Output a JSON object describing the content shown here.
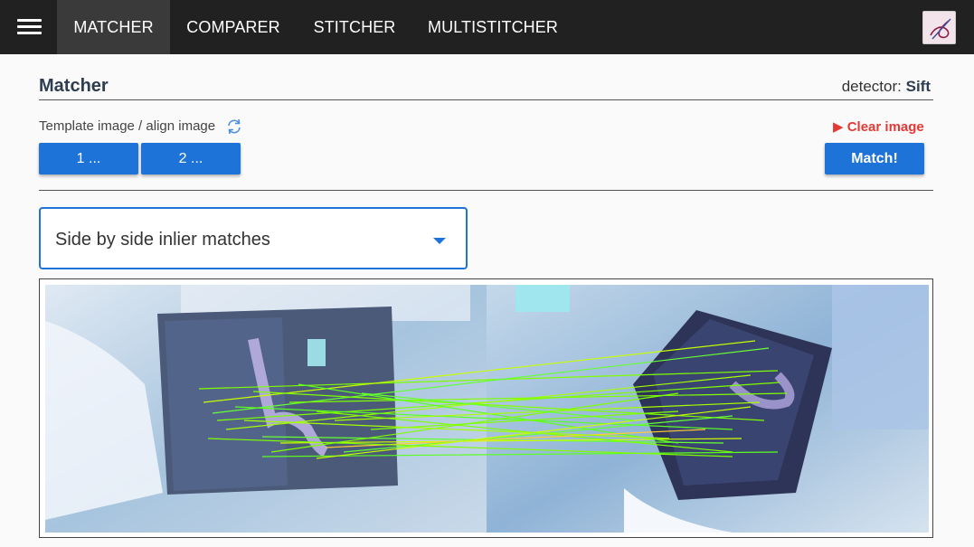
{
  "nav": {
    "tabs": [
      "MATCHER",
      "COMPARER",
      "STITCHER",
      "MULTISTITCHER"
    ],
    "active": "MATCHER"
  },
  "header": {
    "title": "Matcher",
    "detector_label": "detector:",
    "detector_value": "Sift"
  },
  "controls": {
    "template_label": "Template image / align image",
    "clear_label": "Clear image",
    "image1_button": "1 ...",
    "image2_button": "2 ...",
    "match_button": "Match!"
  },
  "view_select": {
    "value": "Side by side inlier matches"
  },
  "colors": {
    "accent": "#1e73d9",
    "topbar": "#212121",
    "clear": "#e53935",
    "match_lines": "#7fff00"
  }
}
